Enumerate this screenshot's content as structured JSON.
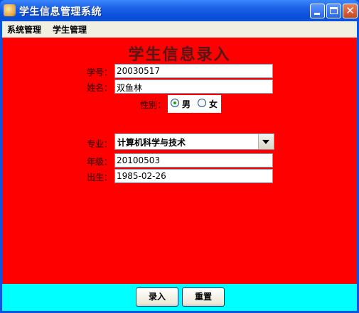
{
  "window": {
    "title": "学生信息管理系统"
  },
  "menu": [
    "系统管理",
    "学生管理"
  ],
  "form": {
    "heading": "学生信息录入",
    "student_id_label": "学号：",
    "student_id": "20030517",
    "name_label": "姓名：",
    "name": "双鱼林",
    "gender_label": "性别：",
    "gender_options": [
      "男",
      "女"
    ],
    "gender_selected": "男",
    "major_label": "专业：",
    "major": "计算机科学与技术",
    "grade_label": "年级：",
    "grade": "20100503",
    "birth_label": "出生：",
    "birth": "1985-02-26"
  },
  "buttons": {
    "submit": "录入",
    "reset": "重置"
  },
  "colors": {
    "form_bg": "#ff0000",
    "button_bar_bg": "#00ffff",
    "title_bar": "#0a52dd"
  }
}
